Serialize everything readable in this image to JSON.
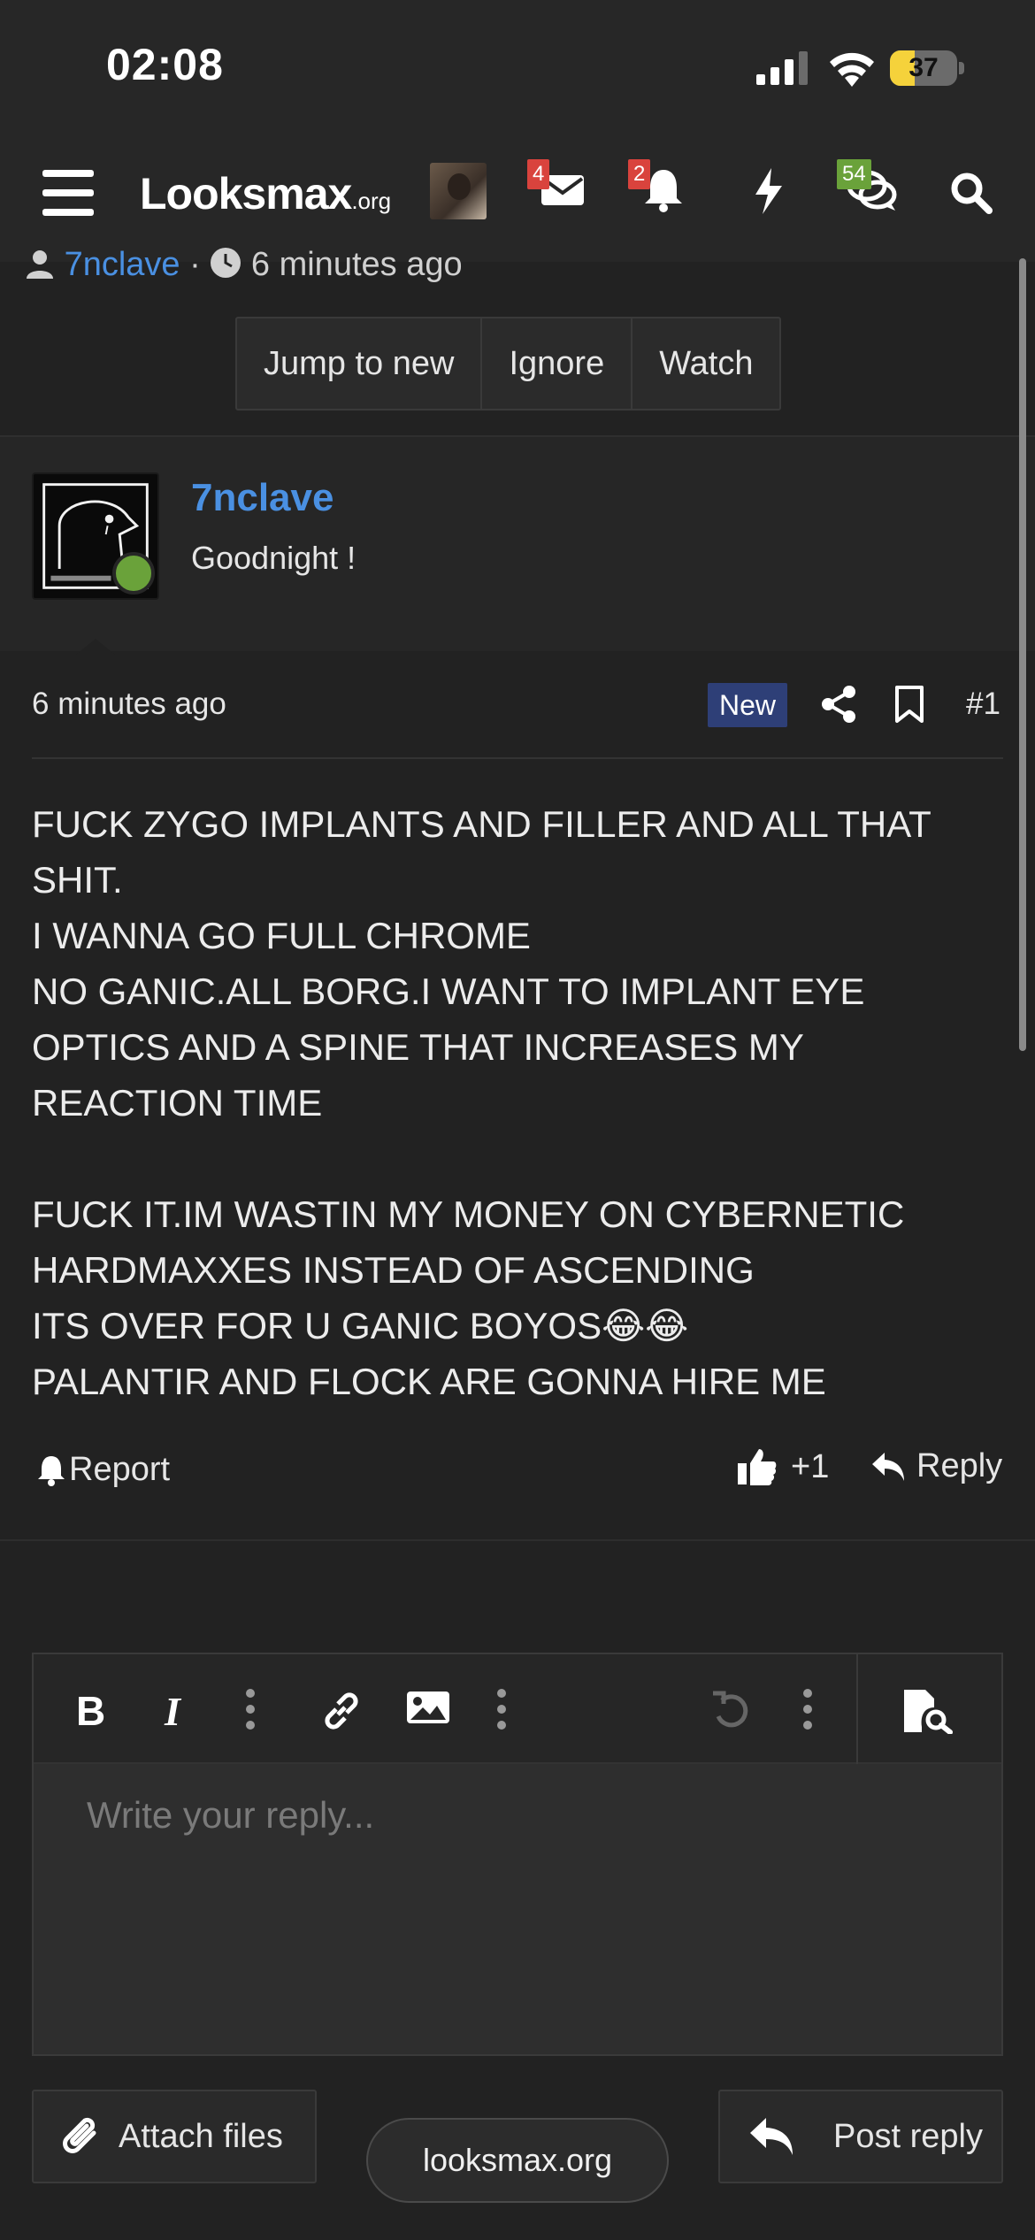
{
  "status_bar": {
    "time": "02:08",
    "battery": "37",
    "battery_level": 0.37
  },
  "nav": {
    "logo_main": "Looksmax",
    "logo_suffix": ".org",
    "badges": {
      "conversations": "4",
      "alerts": "2",
      "whats_new": "54"
    },
    "icons": [
      "menu-icon",
      "avatar",
      "envelope-icon",
      "bell-icon",
      "bolt-icon",
      "chat-bubbles-icon",
      "search-icon"
    ]
  },
  "thread_meta": {
    "author": "7nclave",
    "separator": "·",
    "time": "6 minutes ago"
  },
  "thread_buttons": [
    "Jump to new",
    "Ignore",
    "Watch"
  ],
  "post": {
    "username": "7nclave",
    "user_title": "Goodnight !",
    "date": "6 minutes ago",
    "new_label": "New",
    "number": "#1",
    "body": "FUCK ZYGO IMPLANTS AND FILLER AND ALL THAT SHIT.\nI WANNA GO FULL CHROME\nNO GANIC.ALL BORG.I WANT TO IMPLANT EYE OPTICS AND A SPINE THAT INCREASES MY REACTION TIME\n\nFUCK IT.IM WASTIN MY MONEY ON CYBERNETIC HARDMAXXES INSTEAD OF ASCENDING\nITS OVER FOR U GANIC BOYOS😂😂\nPALANTIR AND FLOCK ARE GONNA HIRE ME",
    "report_label": "Report",
    "reaction_count": "+1",
    "reply_label": "Reply"
  },
  "editor": {
    "placeholder": "Write your reply...",
    "tools": [
      "bold-icon",
      "italic-icon",
      "more-icon",
      "link-icon",
      "image-icon",
      "more-icon",
      "undo-icon",
      "more-icon",
      "preview-icon"
    ]
  },
  "footer": {
    "attach_label": "Attach files",
    "url": "looksmax.org",
    "post_reply_label": "Post reply"
  }
}
